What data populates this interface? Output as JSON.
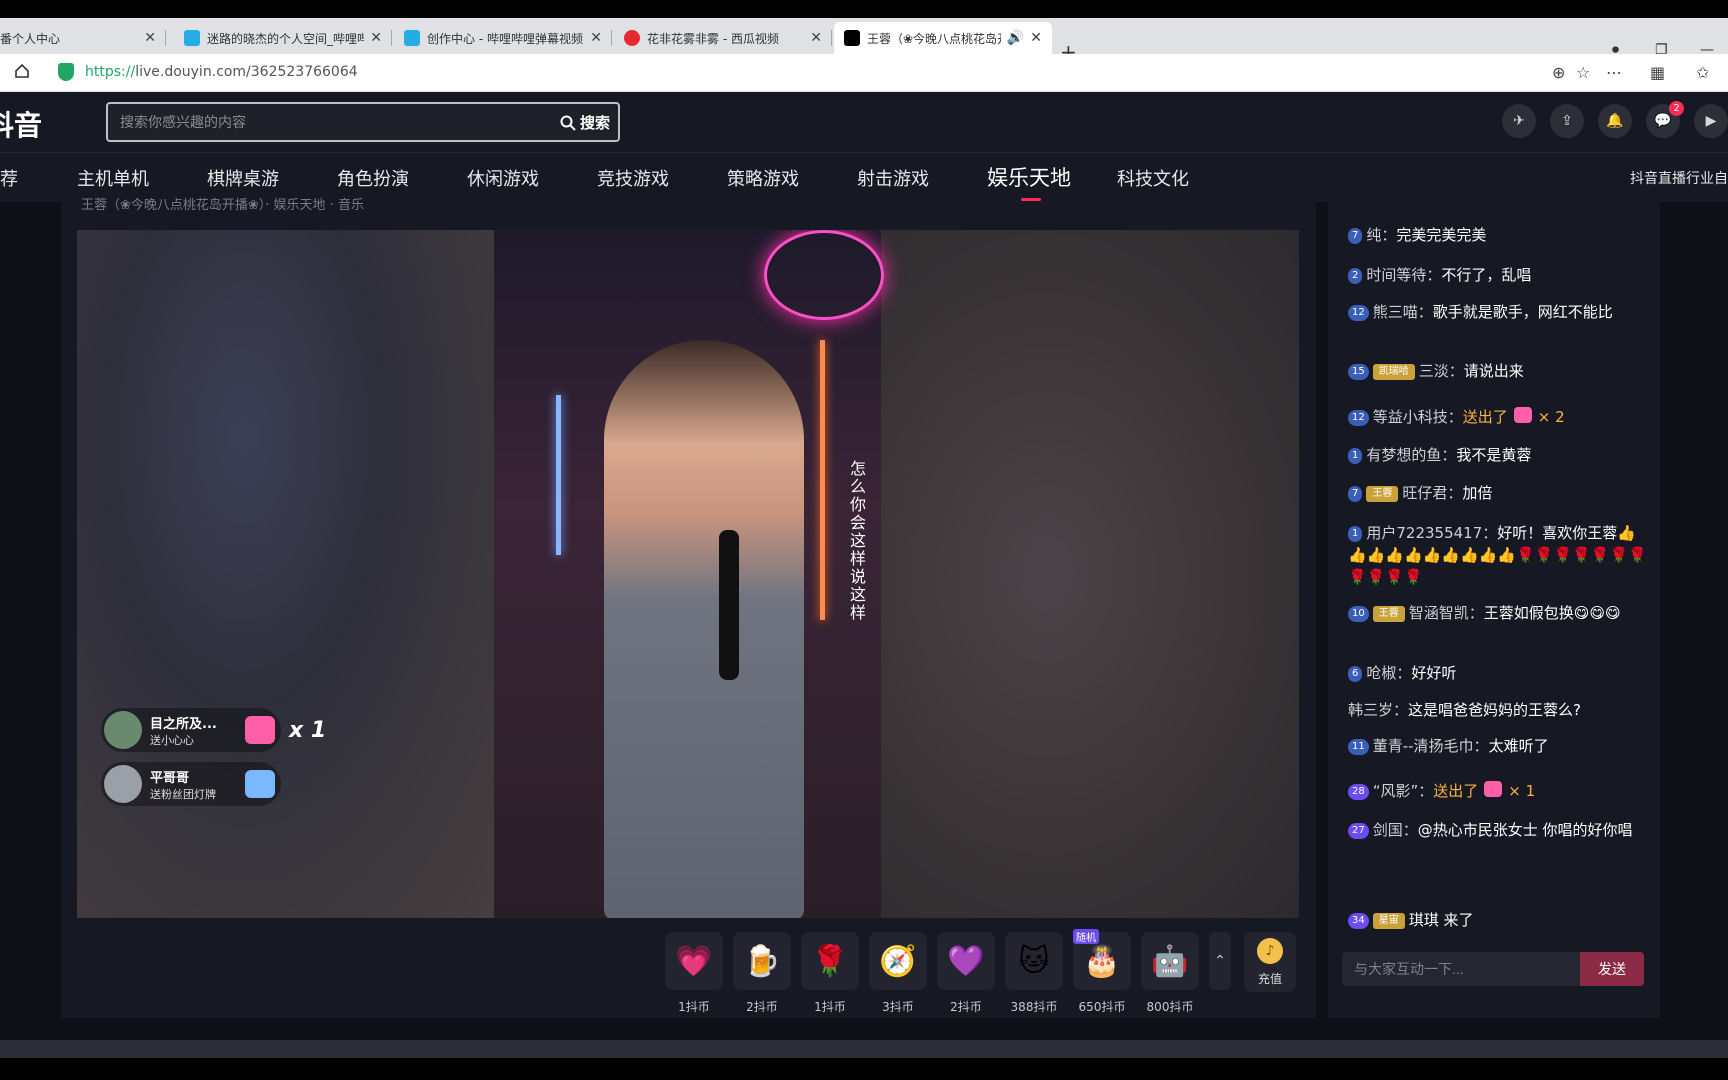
{
  "browser": {
    "tabs": [
      {
        "title": "番个人中心",
        "favicon_color": "#dfe1e5"
      },
      {
        "title": "迷路的晓杰的个人空间_哔哩哔",
        "favicon_color": "#23ade5"
      },
      {
        "title": "创作中心 - 哔哩哔哩弹幕视频",
        "favicon_color": "#23ade5"
      },
      {
        "title": "花非花雾非雾 - 西瓜视频",
        "favicon_color": "#e6292c"
      },
      {
        "title": "王蓉（❀今晚八点桃花岛开",
        "favicon_color": "#000000",
        "audio_icon": "🔊"
      }
    ],
    "close_glyph": "✕",
    "new_tab_glyph": "+",
    "url_scheme": "https://",
    "url_rest": "live.douyin.com/362523766064"
  },
  "header": {
    "logo": "抖音",
    "search_placeholder": "搜索你感兴趣的内容",
    "search_button": "搜索",
    "message_badge": "2"
  },
  "nav": {
    "items": [
      "推荐",
      "主机单机",
      "棋牌桌游",
      "角色扮演",
      "休闲游戏",
      "竞技游戏",
      "策略游戏",
      "射击游戏",
      "娱乐天地",
      "科技文化"
    ],
    "active": "娱乐天地",
    "right_text": "抖音直播行业自"
  },
  "stream": {
    "subbar_text": "王蓉（❀今晚八点桃花岛开播❀）· 娱乐天地 · 音乐",
    "lyrics": "怎么你会这样说这样",
    "gift_pops": [
      {
        "name": "目之所及...",
        "action": "送小心心",
        "count": "x 1",
        "avatar_color": "#6a8a70",
        "gift_color": "#ff5fa8"
      },
      {
        "name": "平哥哥",
        "action": "送粉丝团灯牌",
        "count": "",
        "avatar_color": "#9aa0a8",
        "gift_color": "#7ab8ff"
      }
    ]
  },
  "gifts": [
    {
      "icon": "💗",
      "price": "1抖币",
      "tag": ""
    },
    {
      "icon": "🍺",
      "price": "2抖币",
      "tag": ""
    },
    {
      "icon": "🌹",
      "price": "1抖币",
      "tag": ""
    },
    {
      "icon": "🧭",
      "price": "3抖币",
      "tag": ""
    },
    {
      "icon": "💜",
      "price": "2抖币",
      "tag": ""
    },
    {
      "icon": "🐱",
      "price": "388抖币",
      "tag": ""
    },
    {
      "icon": "🎂",
      "price": "650抖币",
      "tag": "随机"
    },
    {
      "icon": "🤖",
      "price": "800抖币",
      "tag": ""
    }
  ],
  "recharge_label": "充值",
  "chat": {
    "messages": [
      {
        "level": "7",
        "fan": "",
        "user": "纯：",
        "text": "完美完美完美",
        "sent": false
      },
      {
        "level": "2",
        "fan": "",
        "user": "时间等待：",
        "text": "不行了，乱唱",
        "sent": false
      },
      {
        "level": "12",
        "fan": "",
        "user": "熊三喵：",
        "text": "歌手就是歌手，网红不能比",
        "sent": false
      },
      {
        "level": "15",
        "fan": "凯瑞哈",
        "user": "三淡：",
        "text": "请说出来",
        "sent": false
      },
      {
        "level": "12",
        "fan": "",
        "user": "等益小科技：",
        "text": "送出了",
        "sent": true,
        "count": "× 2"
      },
      {
        "level": "1",
        "fan": "",
        "user": "有梦想的鱼：",
        "text": "我不是黄蓉",
        "sent": false
      },
      {
        "level": "7",
        "fan": "王蓉",
        "user": "旺仔君：",
        "text": "加倍",
        "sent": false
      },
      {
        "level": "1",
        "fan": "",
        "user": "用户722355417：",
        "text": "好听！喜欢你王蓉👍👍👍👍👍👍👍👍👍👍🌹🌹🌹🌹🌹🌹🌹🌹🌹🌹🌹",
        "sent": false
      },
      {
        "level": "10",
        "fan": "王蓉",
        "user": "智涵智凯：",
        "text": "王蓉如假包换😋😋😋",
        "sent": false
      },
      {
        "level": "6",
        "fan": "",
        "user": "呛椒：",
        "text": "好好听",
        "sent": false
      },
      {
        "level": "",
        "fan": "",
        "user": "韩三岁：",
        "text": "这是唱爸爸妈妈的王蓉么?",
        "sent": false
      },
      {
        "level": "11",
        "fan": "",
        "user": "董青--清扬毛巾：",
        "text": "太难听了",
        "sent": false
      },
      {
        "level": "28",
        "fan": "",
        "user": "“风影”：",
        "text": "送出了",
        "sent": true,
        "count": "× 1"
      },
      {
        "level": "27",
        "fan": "",
        "user": "剑国：",
        "text": "@热心市民张女士 你唱的好你唱",
        "sent": false
      },
      {
        "level": "34",
        "fan": "星宙",
        "user": "琪琪",
        "text": "来了",
        "sent": false
      }
    ],
    "input_placeholder": "与大家互动一下...",
    "send_button": "发送"
  }
}
